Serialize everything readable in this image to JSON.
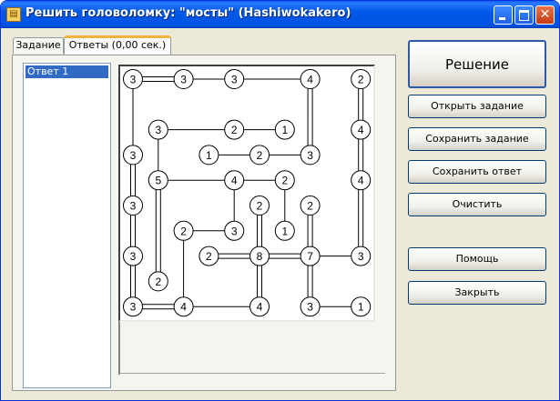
{
  "window": {
    "title": "Решить головоломку: \"мосты\" (Hashiwokakero)",
    "icon": "book-icon",
    "close_glyph": "✕"
  },
  "tabs": [
    {
      "label": "Задание",
      "active": false
    },
    {
      "label": "Ответы (0,00 сек.)",
      "active": true
    }
  ],
  "answers_list": {
    "items": [
      "Ответ 1"
    ],
    "selected_index": 0
  },
  "buttons": {
    "solve": "Решение",
    "open_task": "Открыть задание",
    "save_task": "Сохранить задание",
    "save_answer": "Сохранить ответ",
    "clear": "Очистить",
    "help": "Помощь",
    "close": "Закрыть"
  },
  "puzzle": {
    "grid_size": 10,
    "islands": [
      {
        "col": 0,
        "row": 0,
        "value": 3
      },
      {
        "col": 2,
        "row": 0,
        "value": 3
      },
      {
        "col": 4,
        "row": 0,
        "value": 3
      },
      {
        "col": 7,
        "row": 0,
        "value": 4
      },
      {
        "col": 9,
        "row": 0,
        "value": 2
      },
      {
        "col": 1,
        "row": 2,
        "value": 3
      },
      {
        "col": 4,
        "row": 2,
        "value": 2
      },
      {
        "col": 6,
        "row": 2,
        "value": 1
      },
      {
        "col": 9,
        "row": 2,
        "value": 4
      },
      {
        "col": 0,
        "row": 3,
        "value": 3
      },
      {
        "col": 3,
        "row": 3,
        "value": 1
      },
      {
        "col": 5,
        "row": 3,
        "value": 2
      },
      {
        "col": 7,
        "row": 3,
        "value": 3
      },
      {
        "col": 1,
        "row": 4,
        "value": 5
      },
      {
        "col": 4,
        "row": 4,
        "value": 4
      },
      {
        "col": 6,
        "row": 4,
        "value": 2
      },
      {
        "col": 9,
        "row": 4,
        "value": 4
      },
      {
        "col": 0,
        "row": 5,
        "value": 3
      },
      {
        "col": 5,
        "row": 5,
        "value": 2
      },
      {
        "col": 7,
        "row": 5,
        "value": 2
      },
      {
        "col": 2,
        "row": 6,
        "value": 2
      },
      {
        "col": 4,
        "row": 6,
        "value": 3
      },
      {
        "col": 6,
        "row": 6,
        "value": 1
      },
      {
        "col": 0,
        "row": 7,
        "value": 3
      },
      {
        "col": 3,
        "row": 7,
        "value": 2
      },
      {
        "col": 5,
        "row": 7,
        "value": 8
      },
      {
        "col": 7,
        "row": 7,
        "value": 7
      },
      {
        "col": 9,
        "row": 7,
        "value": 3
      },
      {
        "col": 1,
        "row": 8,
        "value": 2
      },
      {
        "col": 0,
        "row": 9,
        "value": 3
      },
      {
        "col": 2,
        "row": 9,
        "value": 4
      },
      {
        "col": 5,
        "row": 9,
        "value": 4
      },
      {
        "col": 7,
        "row": 9,
        "value": 3
      },
      {
        "col": 9,
        "row": 9,
        "value": 1
      }
    ],
    "bridges": [
      {
        "a": [
          0,
          0
        ],
        "b": [
          2,
          0
        ],
        "count": 2
      },
      {
        "a": [
          2,
          0
        ],
        "b": [
          4,
          0
        ],
        "count": 1
      },
      {
        "a": [
          4,
          0
        ],
        "b": [
          7,
          0
        ],
        "count": 1
      },
      {
        "a": [
          7,
          0
        ],
        "b": [
          7,
          3
        ],
        "count": 2
      },
      {
        "a": [
          9,
          0
        ],
        "b": [
          9,
          2
        ],
        "count": 2
      },
      {
        "a": [
          0,
          0
        ],
        "b": [
          0,
          3
        ],
        "count": 1
      },
      {
        "a": [
          1,
          2
        ],
        "b": [
          4,
          2
        ],
        "count": 1
      },
      {
        "a": [
          4,
          2
        ],
        "b": [
          6,
          2
        ],
        "count": 1
      },
      {
        "a": [
          1,
          2
        ],
        "b": [
          1,
          4
        ],
        "count": 1
      },
      {
        "a": [
          9,
          2
        ],
        "b": [
          9,
          4
        ],
        "count": 2
      },
      {
        "a": [
          3,
          3
        ],
        "b": [
          5,
          3
        ],
        "count": 1
      },
      {
        "a": [
          5,
          3
        ],
        "b": [
          7,
          3
        ],
        "count": 1
      },
      {
        "a": [
          0,
          3
        ],
        "b": [
          0,
          5
        ],
        "count": 2
      },
      {
        "a": [
          1,
          4
        ],
        "b": [
          4,
          4
        ],
        "count": 1
      },
      {
        "a": [
          4,
          4
        ],
        "b": [
          6,
          4
        ],
        "count": 1
      },
      {
        "a": [
          4,
          4
        ],
        "b": [
          4,
          6
        ],
        "count": 1
      },
      {
        "a": [
          6,
          4
        ],
        "b": [
          6,
          6
        ],
        "count": 1
      },
      {
        "a": [
          1,
          4
        ],
        "b": [
          1,
          8
        ],
        "count": 2
      },
      {
        "a": [
          9,
          4
        ],
        "b": [
          9,
          7
        ],
        "count": 2
      },
      {
        "a": [
          5,
          5
        ],
        "b": [
          5,
          7
        ],
        "count": 2
      },
      {
        "a": [
          7,
          5
        ],
        "b": [
          7,
          7
        ],
        "count": 2
      },
      {
        "a": [
          2,
          6
        ],
        "b": [
          4,
          6
        ],
        "count": 1
      },
      {
        "a": [
          2,
          6
        ],
        "b": [
          2,
          9
        ],
        "count": 1
      },
      {
        "a": [
          0,
          5
        ],
        "b": [
          0,
          7
        ],
        "count": 2
      },
      {
        "a": [
          3,
          7
        ],
        "b": [
          5,
          7
        ],
        "count": 2
      },
      {
        "a": [
          5,
          7
        ],
        "b": [
          7,
          7
        ],
        "count": 2
      },
      {
        "a": [
          7,
          7
        ],
        "b": [
          9,
          7
        ],
        "count": 1
      },
      {
        "a": [
          0,
          7
        ],
        "b": [
          0,
          9
        ],
        "count": 2
      },
      {
        "a": [
          5,
          7
        ],
        "b": [
          5,
          9
        ],
        "count": 2
      },
      {
        "a": [
          7,
          7
        ],
        "b": [
          7,
          9
        ],
        "count": 2
      },
      {
        "a": [
          0,
          9
        ],
        "b": [
          2,
          9
        ],
        "count": 2
      },
      {
        "a": [
          2,
          9
        ],
        "b": [
          5,
          9
        ],
        "count": 1
      },
      {
        "a": [
          9,
          9
        ],
        "b": [
          9,
          9
        ],
        "count": 0
      },
      {
        "a": [
          7,
          9
        ],
        "b": [
          9,
          9
        ],
        "count": 1
      }
    ]
  }
}
